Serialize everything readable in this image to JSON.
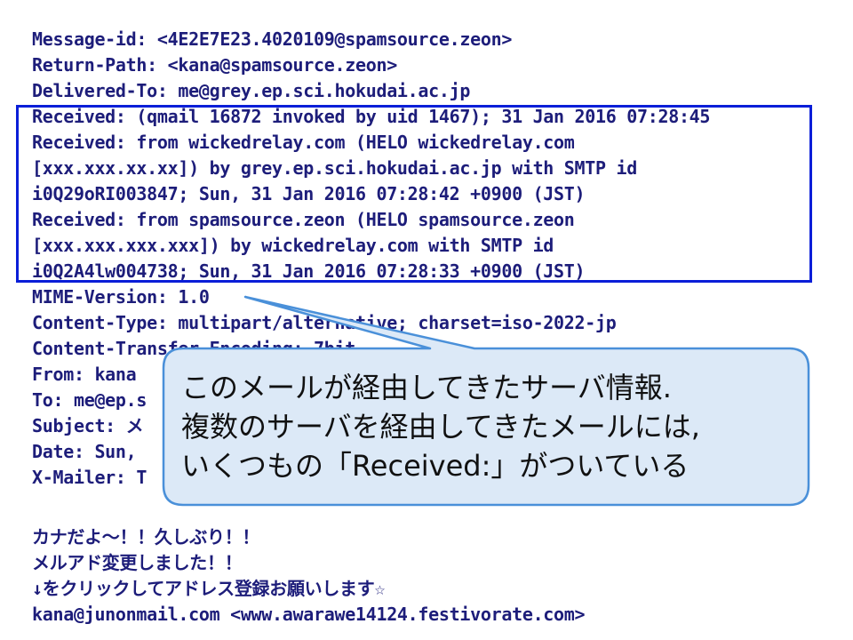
{
  "header_lines": [
    "Message-id: <4E2E7E23.4020109@spamsource.zeon>",
    "Return-Path: <kana@spamsource.zeon>",
    "Delivered-To: me@grey.ep.sci.hokudai.ac.jp",
    "Received: (qmail 16872 invoked by uid 1467); 31 Jan 2016 07:28:45",
    "Received: from wickedrelay.com (HELO wickedrelay.com",
    "[xxx.xxx.xx.xx]) by grey.ep.sci.hokudai.ac.jp with SMTP id",
    "i0Q29oRI003847; Sun, 31 Jan 2016 07:28:42 +0900 (JST)",
    "Received: from spamsource.zeon (HELO spamsource.zeon",
    "[xxx.xxx.xxx.xxx]) by wickedrelay.com with SMTP id",
    "i0Q2A4lw004738; Sun, 31 Jan 2016 07:28:33 +0900 (JST)",
    "MIME-Version: 1.0",
    "Content-Type: multipart/alternative; charset=iso-2022-jp",
    "Content-Transfer-Encoding: 7bit",
    "From: kana",
    "To: me@ep.s",
    "Subject: メ",
    "Date: Sun,",
    "X-Mailer: T"
  ],
  "body_lines": [
    "カナだよ～！！久しぶり！！",
    "メルアド変更しました！！",
    "↓をクリックしてアドレス登録お願いします☆",
    "kana@junonmail.com <www.awarawe14124.festivorate.com>"
  ],
  "callout": {
    "lines": [
      "このメールが経由してきたサーバ情報.",
      "複数のサーバを経由してきたメールには,",
      "いくつもの「Received:」がついている"
    ],
    "fill_color": "#dce9f7",
    "border_color": "#4a90d9"
  },
  "highlight_color": "#0a1ed8",
  "text_color": "#1d1d7a"
}
